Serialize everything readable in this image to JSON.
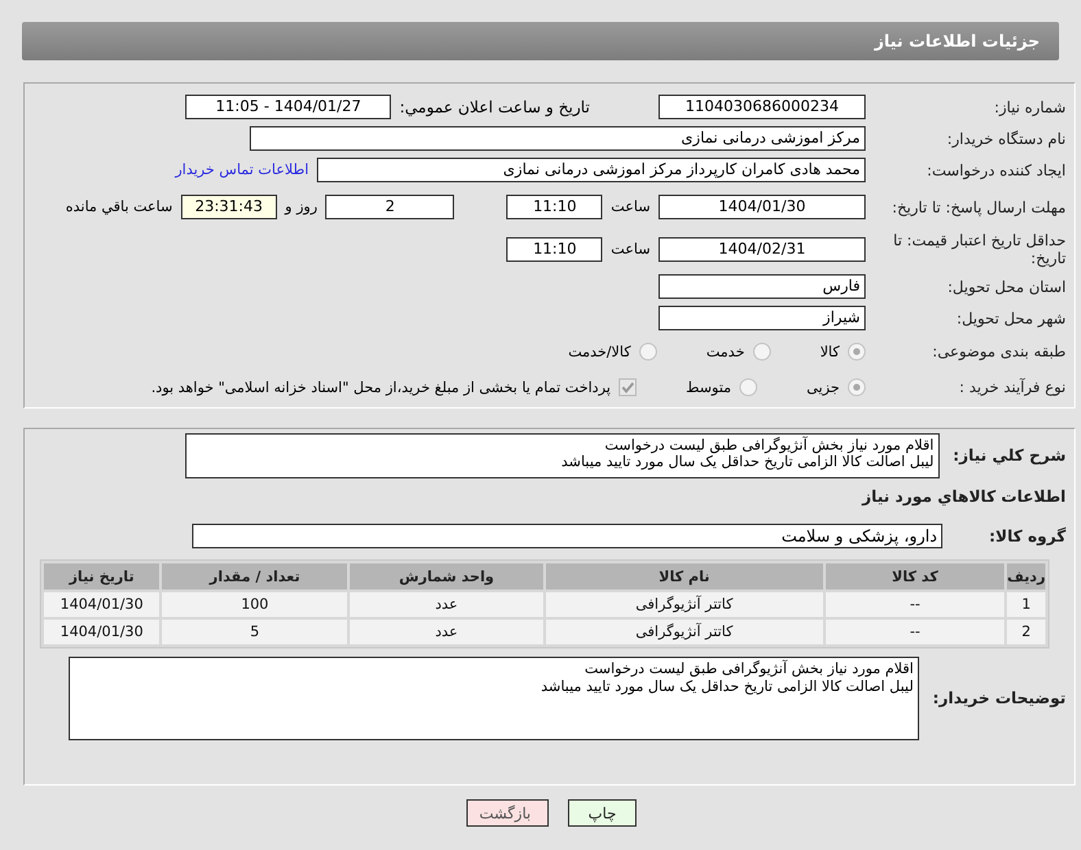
{
  "header": {
    "title": "جزئیات اطلاعات نیاز"
  },
  "form": {
    "need_number": {
      "label": "شماره نیاز:",
      "value": "1104030686000234"
    },
    "announce": {
      "label": "تاریخ و ساعت اعلان عمومي:",
      "value": "1404/01/27 - 11:05"
    },
    "buyer": {
      "label": "نام دستگاه خریدار:",
      "value": "مرکز اموزشی درمانی نمازی"
    },
    "creator": {
      "label": "ایجاد کننده درخواست:",
      "value": "محمد هادی کامران کارپرداز مرکز اموزشی درمانی نمازی",
      "link": "اطلاعات تماس خریدار"
    },
    "reply_deadline": {
      "label": "مهلت ارسال پاسخ: تا تاریخ:",
      "date": "1404/01/30",
      "time_label": "ساعت",
      "time": "11:10",
      "days": "2",
      "days_label": "روز و",
      "remaining": "23:31:43",
      "remaining_label": "ساعت باقي مانده"
    },
    "price_validity": {
      "label": "حداقل تاریخ اعتبار قیمت: تا تاریخ:",
      "date": "1404/02/31",
      "time_label": "ساعت",
      "time": "11:10"
    },
    "province": {
      "label": "استان محل تحویل:",
      "value": "فارس"
    },
    "city": {
      "label": "شهر محل تحویل:",
      "value": "شیراز"
    },
    "category": {
      "label": "طبقه بندی موضوعی:",
      "options": [
        {
          "label": "کالا",
          "selected": true
        },
        {
          "label": "خدمت",
          "selected": false
        },
        {
          "label": "کالا/خدمت",
          "selected": false
        }
      ]
    },
    "process": {
      "label": "نوع فرآیند خرید :",
      "options": [
        {
          "label": "جزیی",
          "selected": true
        },
        {
          "label": "متوسط",
          "selected": false
        }
      ],
      "payment": {
        "checked": true,
        "text": "پرداخت تمام یا بخشی از مبلغ خرید،از محل \"اسناد خزانه اسلامی\" خواهد بود."
      }
    }
  },
  "goods": {
    "description": {
      "label": "شرح کلي نیاز:",
      "lines": [
        "اقلام مورد نیاز بخش آنژیوگرافی طبق لیست درخواست",
        "لیبل اصالت کالا الزامی تاریخ حداقل یک سال مورد تایید میباشد"
      ]
    },
    "section_title": "اطلاعات کالاهاي مورد نیاز",
    "group": {
      "label": "گروه کالا:",
      "value": "دارو، پزشکی و سلامت"
    },
    "table": {
      "columns": [
        "ردیف",
        "کد کالا",
        "نام کالا",
        "واحد شمارش",
        "تعداد / مقدار",
        "تاریخ نیاز"
      ],
      "rows": [
        [
          "1",
          "--",
          "کاتتر آنژیوگرافی",
          "عدد",
          "100",
          "1404/01/30"
        ],
        [
          "2",
          "--",
          "کاتتر آنژیوگرافی",
          "عدد",
          "5",
          "1404/01/30"
        ]
      ]
    },
    "buyer_notes": {
      "label": "توضیحات خریدار:",
      "lines": [
        "اقلام مورد نیاز بخش آنژیوگرافی طبق لیست درخواست",
        "لیبل اصالت کالا الزامی تاریخ حداقل یک سال مورد تایید میباشد"
      ]
    }
  },
  "buttons": [
    {
      "label": "چاپ",
      "kind": "print"
    },
    {
      "label": "بازگشت",
      "kind": "back"
    }
  ]
}
